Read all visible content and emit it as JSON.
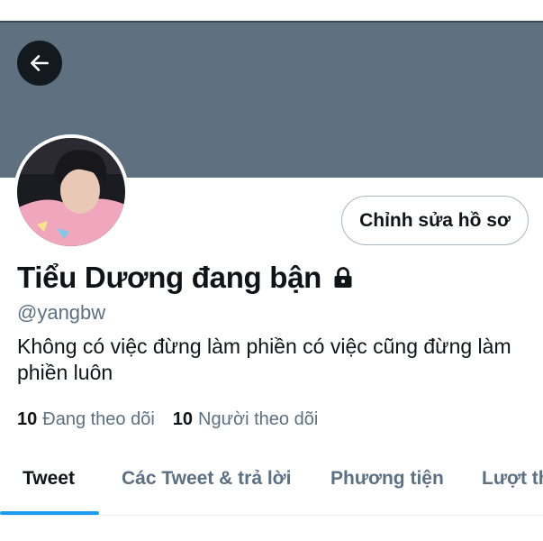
{
  "header": {
    "banner_color": "#5f7080",
    "back_icon": "arrow-left-icon"
  },
  "profile": {
    "display_name": "Tiểu Dương đang bận",
    "handle": "@yangbw",
    "bio": "Không có việc đừng làm phiền có việc cũng đừng làm phiền luôn",
    "lock_icon": "lock-icon",
    "edit_button_label": "Chỉnh sửa hồ sơ"
  },
  "stats": {
    "following_count": "10",
    "following_label": "Đang theo dõi",
    "followers_count": "10",
    "followers_label": "Người theo dõi"
  },
  "tabs": [
    {
      "label": "Tweet",
      "active": true
    },
    {
      "label": "Các Tweet & trả lời",
      "active": false
    },
    {
      "label": "Phương tiện",
      "active": false
    },
    {
      "label": "Lượt th",
      "active": false
    }
  ],
  "colors": {
    "accent": "#1d9bf0",
    "text_primary": "#0f1419",
    "text_secondary": "#5b7083"
  }
}
